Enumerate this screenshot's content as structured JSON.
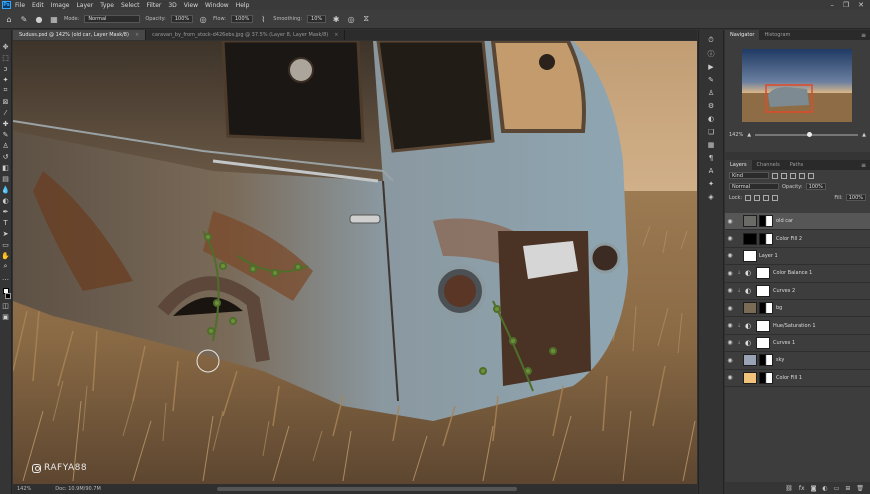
{
  "menubar": {
    "app_logo": "Ps",
    "items": [
      "File",
      "Edit",
      "Image",
      "Layer",
      "Type",
      "Select",
      "Filter",
      "3D",
      "View",
      "Window",
      "Help"
    ],
    "window_controls": [
      "–",
      "❐",
      "✕"
    ]
  },
  "options": {
    "mode_label": "Mode:",
    "mode_value": "Normal",
    "opacity_label": "Opacity:",
    "opacity_value": "100%",
    "flow_label": "Flow:",
    "flow_value": "100%",
    "smoothing_label": "Smoothing:",
    "smoothing_value": "10%"
  },
  "tabs": [
    {
      "label": "Suduss.psd @ 142% (old car, Layer Mask/8)",
      "active": true
    },
    {
      "label": "caravan_by_from_stock-d426ebs.jpg @ 37.5% (Layer 8, Layer Mask/8)",
      "active": false
    }
  ],
  "canvas": {
    "watermark": "RAFYA88"
  },
  "status": {
    "zoom": "142%",
    "doc": "Doc: 10.9M/90.7M"
  },
  "navigator": {
    "tabs": [
      "Navigator",
      "Histogram"
    ],
    "zoom": "142%",
    "zoom_fraction": 0.52
  },
  "layers": {
    "tabs": [
      "Layers",
      "Channels",
      "Paths"
    ],
    "filter_label": "Kind",
    "blend_mode": "Normal",
    "opacity_label": "Opacity:",
    "opacity_value": "100%",
    "lock_label": "Lock:",
    "fill_label": "Fill:",
    "fill_value": "100%",
    "items": [
      {
        "name": "old car",
        "selected": true,
        "kind": "masked"
      },
      {
        "name": "Color Fill 2",
        "selected": false,
        "kind": "fill"
      },
      {
        "name": "Layer 1",
        "selected": false,
        "kind": "plain"
      },
      {
        "name": "Color Balance 1",
        "selected": false,
        "kind": "adjust"
      },
      {
        "name": "Curves 2",
        "selected": false,
        "kind": "adjust"
      },
      {
        "name": "bg",
        "selected": false,
        "kind": "masked"
      },
      {
        "name": "Hue/Saturation 1",
        "selected": false,
        "kind": "adjust"
      },
      {
        "name": "Curves 1",
        "selected": false,
        "kind": "adjust"
      },
      {
        "name": "sky",
        "selected": false,
        "kind": "masked"
      },
      {
        "name": "Color Fill 1",
        "selected": false,
        "kind": "fill"
      }
    ],
    "footer_icons": [
      "link-icon",
      "fx-icon",
      "mask-icon",
      "adjustment-icon",
      "group-icon",
      "new-layer-icon",
      "trash-icon"
    ]
  },
  "colors": {
    "accent_selection": "#565656",
    "nav_viewbox": "#e04a2a"
  }
}
